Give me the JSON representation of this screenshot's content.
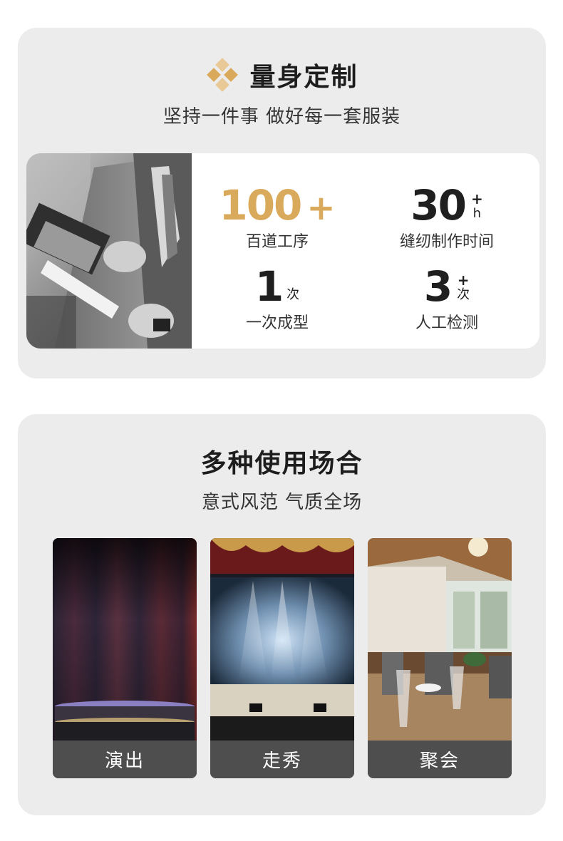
{
  "custom": {
    "title": "量身定制",
    "subtitle": "坚持一件事  做好每一套服装",
    "stats": [
      {
        "number": "100",
        "plus": "+",
        "unit": "",
        "label": "百道工序"
      },
      {
        "number": "30",
        "plus": "+",
        "unit": "h",
        "label": "缝纫制作时间"
      },
      {
        "number": "1",
        "plus": "",
        "unit": "次",
        "label": "一次成型"
      },
      {
        "number": "3",
        "plus": "+",
        "unit": "次",
        "label": "人工检测"
      }
    ]
  },
  "occasions": {
    "title": "多种使用场合",
    "subtitle": "意式风范  气质全场",
    "items": [
      {
        "label": "演出"
      },
      {
        "label": "走秀"
      },
      {
        "label": "聚会"
      }
    ]
  },
  "colors": {
    "accent_gold": "#d9aa5c",
    "panel_bg": "#ececec",
    "label_bg": "#4e4e4e"
  }
}
